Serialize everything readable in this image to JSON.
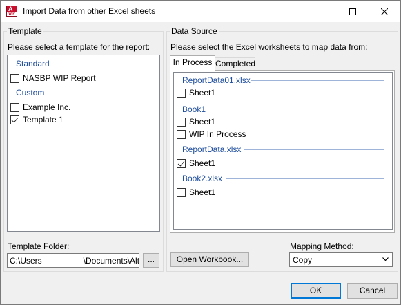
{
  "window": {
    "title": "Import Data from other Excel sheets",
    "icon": "app-icon-wip",
    "icon_letters": "A",
    "icon_subtext": "WIP"
  },
  "template_group": {
    "label": "Template",
    "prompt": "Please select a template for the report:",
    "sections": [
      {
        "name": "Standard",
        "items": [
          {
            "label": "NASBP WIP Report",
            "checked": false
          }
        ]
      },
      {
        "name": "Custom",
        "items": [
          {
            "label": "Example Inc.",
            "checked": false
          },
          {
            "label": "Template 1",
            "checked": true
          }
        ]
      }
    ],
    "folder_label": "Template Folder:",
    "folder_path_start": "C:\\Users",
    "folder_path_end": "\\Documents\\Altov",
    "browse_label": "..."
  },
  "data_source_group": {
    "label": "Data Source",
    "prompt": "Please select the Excel worksheets to map data from:",
    "tabs": [
      {
        "label": "In Process",
        "active": true
      },
      {
        "label": "Completed",
        "active": false
      }
    ],
    "workbooks": [
      {
        "name": "ReportData01.xlsx",
        "sheets": [
          {
            "label": "Sheet1",
            "checked": false
          }
        ]
      },
      {
        "name": "Book1",
        "sheets": [
          {
            "label": "Sheet1",
            "checked": false
          },
          {
            "label": "WIP In Process",
            "checked": false
          }
        ]
      },
      {
        "name": "ReportData.xlsx",
        "sheets": [
          {
            "label": "Sheet1",
            "checked": true
          }
        ]
      },
      {
        "name": "Book2.xlsx",
        "sheets": [
          {
            "label": "Sheet1",
            "checked": false
          }
        ]
      }
    ],
    "open_workbook_label": "Open Workbook...",
    "mapping_label": "Mapping Method:",
    "mapping_value": "Copy"
  },
  "footer": {
    "ok_label": "OK",
    "cancel_label": "Cancel"
  },
  "colors": {
    "accent": "#0078d7",
    "section_heading": "#1f4e9d",
    "section_rule": "#9fb4d9"
  }
}
